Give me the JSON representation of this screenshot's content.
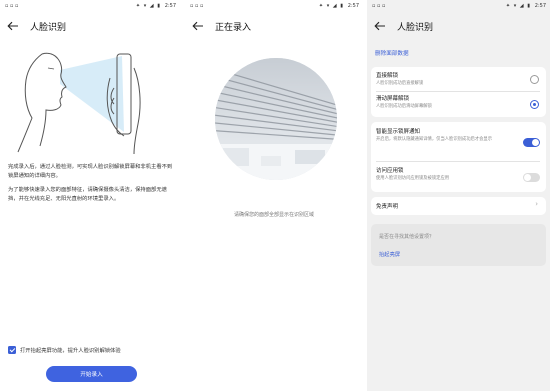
{
  "screen1": {
    "status": {
      "left": "▫ ▫ ▫",
      "icons": "✦ ▾ ◢ ▮",
      "time": "2:57"
    },
    "title": "人脸识别",
    "para1": "完成录入后，通过人脸检测，可实现人脸识别解锁屏幕和非机主看不到锁屏通知的详细内容。",
    "para2": "为了能够快速录入您的面部特征，请确保摄像头清洁，保持面部无遮挡，并在光线充足、无阳光直射的环境里录入。",
    "checkbox_label": "打开抬起亮屏功能，提升人脸识别解锁体验",
    "start_button": "开始录入"
  },
  "screen2": {
    "status": {
      "left": "▫ ▫ ▫",
      "icons": "✦ ▾ ◢ ▮",
      "time": "2:57"
    },
    "title": "正在录入",
    "hint": "请确保您的面部全部显示在识别区域"
  },
  "screen3": {
    "status": {
      "left": "▫ ▫ ▫",
      "icons": "✦ ▾ ◢ ▮",
      "time": "2:57"
    },
    "title": "人脸识别",
    "delete_link": "删除面部数据",
    "direct_unlock": {
      "title": "直接解锁",
      "subtitle": "人脸识别成功后直接解锁"
    },
    "slide_unlock": {
      "title": "滑动屏幕解锁",
      "subtitle": "人脸识别成功后滑动屏幕解锁"
    },
    "smart_notify": {
      "title": "智能显示锁屏通知",
      "subtitle": "开启后，将默认隐藏通知详情，仅当人脸识别成功后才会显示"
    },
    "app_lock": {
      "title": "访问应用锁",
      "subtitle": "使用人脸识别访问应用锁及被锁定应用"
    },
    "disclaimer": "免责声明",
    "question": "是否在寻找其他设置项？",
    "raise_link": "抬起亮屏"
  },
  "colors": {
    "accent": "#3b5fd6",
    "button": "#3f63e0"
  },
  "icons": [
    "back-arrow-icon",
    "checkbox-checked-icon",
    "radio-icon",
    "toggle-icon",
    "chevron-right-icon",
    "face-scan-illustration"
  ]
}
